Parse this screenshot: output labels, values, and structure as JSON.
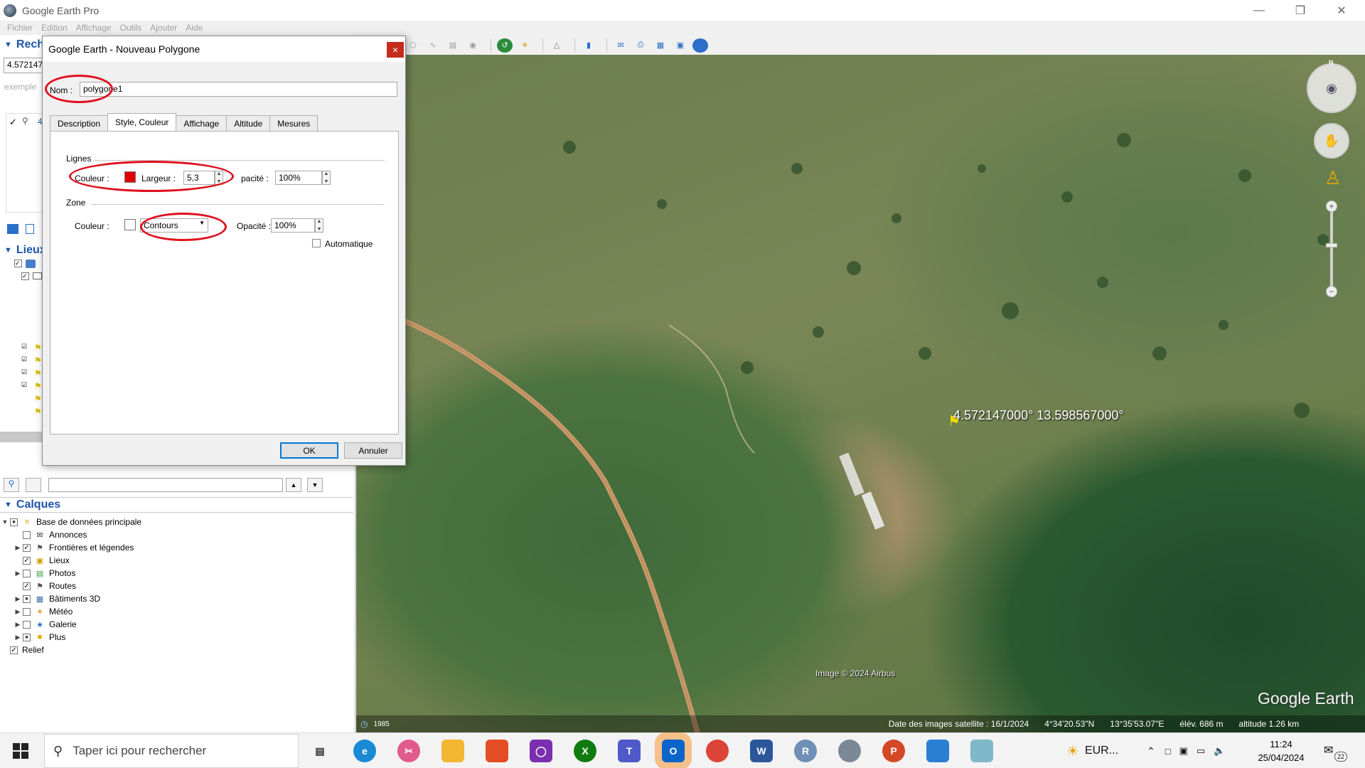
{
  "app": {
    "title": "Google Earth Pro",
    "menus": [
      "Fichier",
      "Edition",
      "Affichage",
      "Outils",
      "Ajouter",
      "Aide"
    ]
  },
  "sidebar": {
    "search_header": "Rech",
    "search_value": "4.572147",
    "search_hint": "exemple",
    "search_result": "4",
    "places_header": "Lieux",
    "layers_header": "Calques",
    "layers": [
      {
        "label": "Base de données principale",
        "checked": "partial",
        "expander": "down",
        "icon": "database-icon",
        "indent": 0
      },
      {
        "label": "Annonces",
        "checked": "false",
        "expander": "",
        "icon": "envelope-icon",
        "indent": 1
      },
      {
        "label": "Frontières et légendes",
        "checked": "true",
        "expander": "right",
        "icon": "flag-icon",
        "indent": 1
      },
      {
        "label": "Lieux",
        "checked": "true",
        "expander": "",
        "icon": "places-icon",
        "indent": 1
      },
      {
        "label": "Photos",
        "checked": "false",
        "expander": "right",
        "icon": "photo-icon",
        "indent": 1
      },
      {
        "label": "Routes",
        "checked": "true",
        "expander": "",
        "icon": "road-icon",
        "indent": 1
      },
      {
        "label": "Bâtiments 3D",
        "checked": "partial",
        "expander": "right",
        "icon": "building-icon",
        "indent": 1
      },
      {
        "label": "Météo",
        "checked": "false",
        "expander": "right",
        "icon": "weather-icon",
        "indent": 1
      },
      {
        "label": "Galerie",
        "checked": "false",
        "expander": "right",
        "icon": "gallery-icon",
        "indent": 1
      },
      {
        "label": "Plus",
        "checked": "partial",
        "expander": "right",
        "icon": "more-icon",
        "indent": 1
      },
      {
        "label": "Relief",
        "checked": "true",
        "expander": "",
        "icon": "",
        "indent": 0
      }
    ]
  },
  "dialog": {
    "title": "Google Earth - Nouveau Polygone",
    "close_label": "×",
    "name_label": "Nom :",
    "name_value": "polygone1",
    "tabs": [
      "Description",
      "Style, Couleur",
      "Affichage",
      "Altitude",
      "Mesures"
    ],
    "active_tab": "Style, Couleur",
    "lines": {
      "group_label": "Lignes",
      "color_label": "Couleur :",
      "color": "#e00000",
      "width_label": "Largeur :",
      "width_value": "5,3",
      "opacity_label": "pacité :",
      "opacity_value": "100%"
    },
    "zone": {
      "group_label": "Zone",
      "color_label": "Couleur :",
      "color": "#ffffff",
      "fill_value": "Contours",
      "opacity_label": "Opacité :",
      "opacity_value": "100%",
      "auto_label": "Automatique"
    },
    "ok_label": "OK",
    "cancel_label": "Annuler",
    "annotation_color": "#e0101e"
  },
  "map": {
    "placemark_label": "4.572147000°  13.598567000°",
    "credit": "Image © 2024 Airbus",
    "logo": "Google Earth",
    "year": "1985",
    "status": {
      "image_date": "Date des images satellite : 16/1/2024",
      "lat": "4°34'20.53\"N",
      "lon": "13°35'53.07\"E",
      "elevation": "élév.  686 m",
      "altitude": "altitude   1.26 km"
    },
    "compass_n": "N"
  },
  "taskbar": {
    "search_placeholder": "Taper ici pour rechercher",
    "weather": "EUR...",
    "time": "11:24",
    "date": "25/04/2024",
    "notifications": "22"
  }
}
